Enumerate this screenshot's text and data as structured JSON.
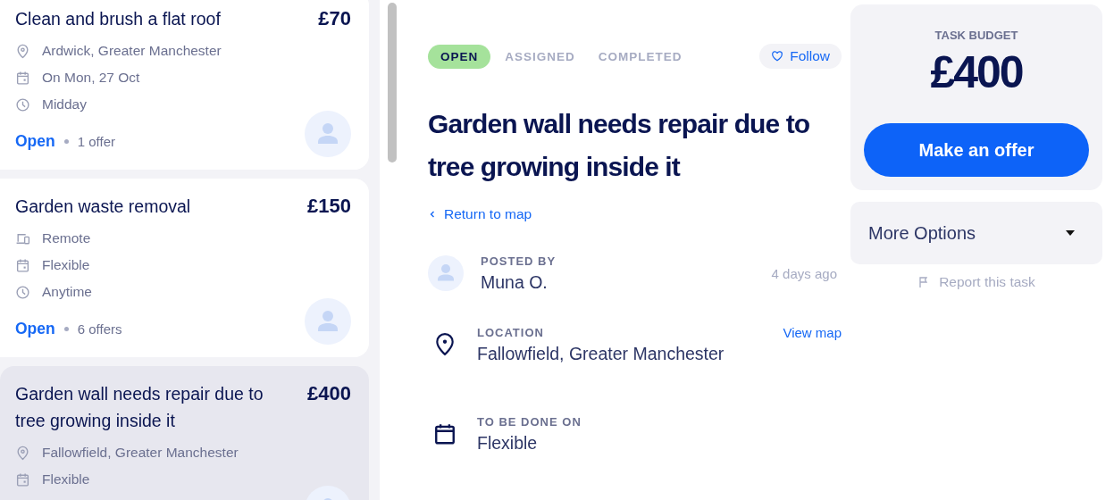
{
  "tasks": [
    {
      "title": "Clean and brush a flat roof",
      "price": "£70",
      "selected": false,
      "meta": [
        {
          "kind": "location",
          "text": "Ardwick, Greater Manchester"
        },
        {
          "kind": "date",
          "text": "On Mon, 27 Oct"
        },
        {
          "kind": "time",
          "text": "Midday"
        }
      ],
      "status": "Open",
      "offers": "1 offer"
    },
    {
      "title": "Garden waste removal",
      "price": "£150",
      "selected": false,
      "meta": [
        {
          "kind": "remote",
          "text": "Remote"
        },
        {
          "kind": "date",
          "text": "Flexible"
        },
        {
          "kind": "time",
          "text": "Anytime"
        }
      ],
      "status": "Open",
      "offers": "6 offers"
    },
    {
      "title": "Garden wall needs repair due to tree growing inside it",
      "price": "£400",
      "selected": true,
      "meta": [
        {
          "kind": "location",
          "text": "Fallowfield, Greater Manchester"
        },
        {
          "kind": "date",
          "text": "Flexible"
        }
      ]
    }
  ],
  "status_tabs": [
    {
      "label": "OPEN",
      "selected": true
    },
    {
      "label": "ASSIGNED",
      "selected": false
    },
    {
      "label": "COMPLETED",
      "selected": false
    }
  ],
  "follow": "Follow",
  "title": "Garden wall needs repair due to tree growing inside it",
  "back_link": "Return to map",
  "details": [
    {
      "kind": "poster",
      "label": "POSTED BY",
      "value": "Muna O.",
      "aside": "4 days ago"
    },
    {
      "kind": "location",
      "label": "LOCATION",
      "value": "Fallowfield, Greater Manchester",
      "link": "View map"
    },
    {
      "kind": "date",
      "label": "TO BE DONE ON",
      "value": "Flexible"
    }
  ],
  "budget": {
    "label": "TASK BUDGET",
    "amount": "£400",
    "button": "Make an offer"
  },
  "more_options": "More Options",
  "report": "Report this task"
}
